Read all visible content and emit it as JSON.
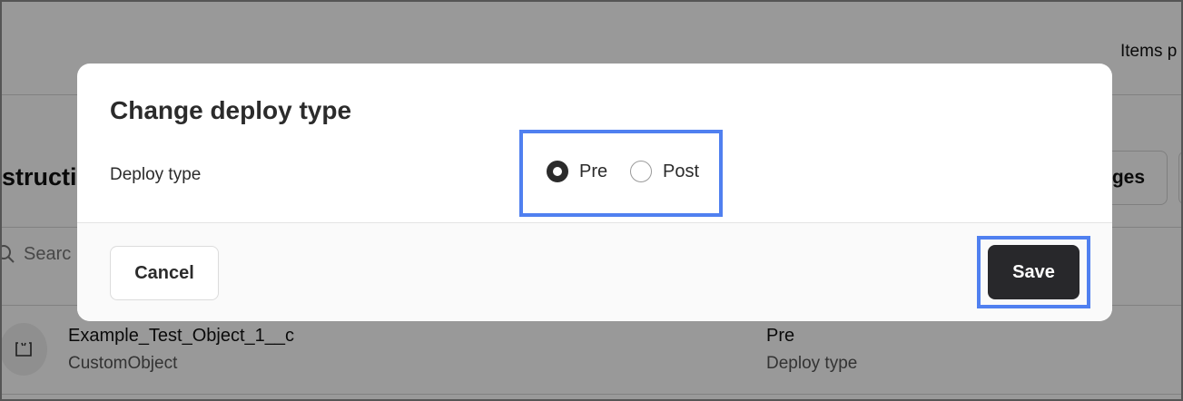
{
  "background": {
    "items_per_page_text": "Items p",
    "page_title": "structi",
    "right_button_label": "ges",
    "search_placeholder": "Searc",
    "row": {
      "icon": "object-icon",
      "name": "Example_Test_Object_1__c",
      "type": "CustomObject",
      "deploy_value": "Pre",
      "deploy_label": "Deploy type"
    }
  },
  "modal": {
    "title": "Change deploy type",
    "field_label": "Deploy type",
    "options": [
      {
        "label": "Pre",
        "checked": true
      },
      {
        "label": "Post",
        "checked": false
      }
    ],
    "cancel_label": "Cancel",
    "save_label": "Save"
  },
  "colors": {
    "highlight": "#5080f0",
    "primary_button": "#28282b",
    "overlay": "rgba(0,0,0,0.40)"
  }
}
